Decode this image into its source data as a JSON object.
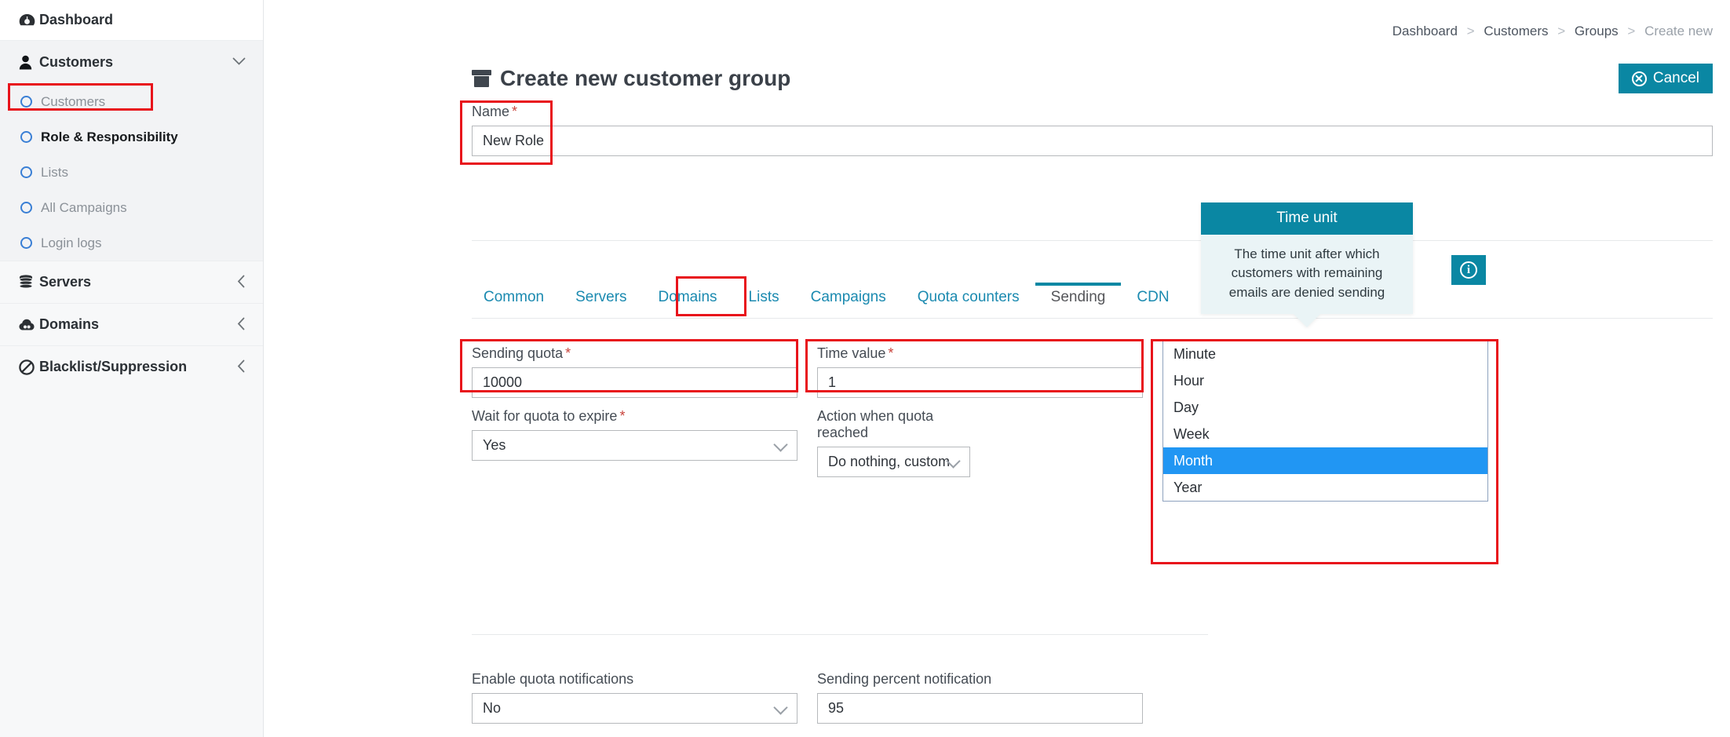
{
  "sidebar": {
    "items": [
      {
        "label": "Dashboard",
        "icon": "dashboard-icon",
        "glyph": "◔",
        "type": "top",
        "caret": ""
      },
      {
        "label": "Customers",
        "icon": "user-icon",
        "glyph": "♟",
        "type": "group",
        "caret": "ˇ"
      }
    ],
    "sub_items": [
      {
        "label": "Customers",
        "icon": "circle-icon",
        "active": false
      },
      {
        "label": "Role & Responsibility",
        "icon": "circle-icon",
        "active": true
      },
      {
        "label": "Lists",
        "icon": "circle-icon",
        "active": false
      },
      {
        "label": "All Campaigns",
        "icon": "circle-icon",
        "active": false
      },
      {
        "label": "Login logs",
        "icon": "circle-icon",
        "active": false
      }
    ],
    "bottom_items": [
      {
        "label": "Servers",
        "icon": "database-icon",
        "caret": "‹"
      },
      {
        "label": "Domains",
        "icon": "cloud-icon",
        "caret": "‹"
      },
      {
        "label": "Blacklist/Suppression",
        "icon": "ban-icon",
        "caret": "‹"
      }
    ]
  },
  "breadcrumb": {
    "items": [
      "Dashboard",
      "Customers",
      "Groups"
    ],
    "current": "Create new",
    "separator": ">"
  },
  "header": {
    "title": "Create new customer group",
    "title_icon": "archive-box-icon",
    "cancel_label": "Cancel",
    "cancel_icon": "cancel-circle-icon"
  },
  "name_field": {
    "label": "Name",
    "required_mark": "*",
    "value": "New Role"
  },
  "tabs": [
    {
      "label": "Common",
      "active": false
    },
    {
      "label": "Servers",
      "active": false
    },
    {
      "label": "Domains",
      "active": false
    },
    {
      "label": "Lists",
      "active": false
    },
    {
      "label": "Campaigns",
      "active": false
    },
    {
      "label": "Quota counters",
      "active": false
    },
    {
      "label": "Sending",
      "active": true
    },
    {
      "label": "CDN",
      "active": false
    }
  ],
  "form": {
    "sending_quota": {
      "label": "Sending quota",
      "required_mark": "*",
      "value": "10000"
    },
    "time_value": {
      "label": "Time value",
      "required_mark": "*",
      "value": "1"
    },
    "time_unit": {
      "label": "Time unit",
      "required_mark": "*",
      "value": "Month"
    },
    "wait_for_quota": {
      "label": "Wait for quota to expire",
      "required_mark": "*",
      "value": "Yes"
    },
    "action_when_quota": {
      "label_line1": "Action when quota",
      "label_line2": "reached",
      "value": "Do nothing, custom"
    },
    "enable_quota_notifications": {
      "label": "Enable quota notifications",
      "value": "No"
    },
    "sending_percent_notification": {
      "label": "Sending percent notification",
      "value": "95"
    }
  },
  "time_unit_dropdown": {
    "options": [
      {
        "label": "Minute",
        "selected": false
      },
      {
        "label": "Hour",
        "selected": false
      },
      {
        "label": "Day",
        "selected": false
      },
      {
        "label": "Week",
        "selected": false
      },
      {
        "label": "Month",
        "selected": true
      },
      {
        "label": "Year",
        "selected": false
      }
    ]
  },
  "tooltip": {
    "title": "Time unit",
    "body": "The time unit after which customers with remaining emails are denied sending"
  },
  "info_button": {
    "icon": "info-icon",
    "glyph": "i"
  },
  "colors": {
    "accent_teal": "#0a87a3",
    "tab_link": "#1b8ab0",
    "highlight_red": "#e8131b",
    "dropdown_selected": "#2196f3",
    "tooltip_body_bg": "#eaf4f6",
    "required_star": "#c9453d"
  }
}
